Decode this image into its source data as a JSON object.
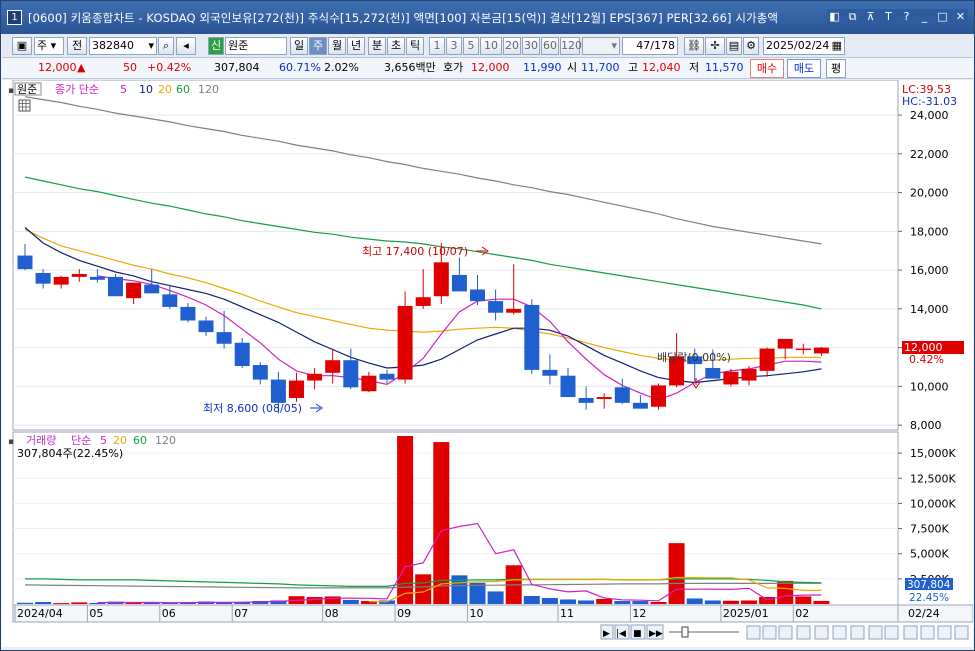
{
  "window": {
    "number": "1",
    "title": "[0600] 키움종합차트 - KOSDAQ 외국인보유[272(천)] 주식수[15,272(천)] 액면[100] 자본금[15(억)] 결산[12월] EPS[367] PER[32.66] 시가총액",
    "controls": [
      "◧",
      "⧉",
      "⊼",
      "T",
      "?",
      "_",
      "□",
      "✕"
    ]
  },
  "toolbar": {
    "period_type": "주",
    "prev_label": "전",
    "code": "382840",
    "name_badge": "신",
    "name": "원준",
    "periods": [
      "일",
      "주",
      "월",
      "년",
      "분",
      "초",
      "틱"
    ],
    "selected_period": "주",
    "numbers": [
      "1",
      "3",
      "5",
      "10",
      "20",
      "30",
      "60",
      "120"
    ],
    "count": "47/178",
    "date": "2025/02/24"
  },
  "quote": {
    "price": "12,000",
    "arrow": "▲",
    "change": "50",
    "change_pct": "+0.42%",
    "volume": "307,804",
    "ratio1": "60.71%",
    "ratio2": "2.02%",
    "amount": "3,656백만",
    "bid_label": "호가",
    "bid1": "12,000",
    "bid2": "11,990",
    "open_label": "시",
    "open": "11,700",
    "high_label": "고",
    "high": "12,040",
    "low_label": "저",
    "low": "11,570",
    "buy": "매수",
    "sell": "매도",
    "flat": "평"
  },
  "price_panel": {
    "legend_name": "원준",
    "legend_ma_label": "종가 단순",
    "ma_periods": [
      "5",
      "10",
      "20",
      "60",
      "120"
    ],
    "lc": "LC:39.53",
    "hc": "HC:-31.03",
    "last_price": "12,000",
    "last_pct": "0.42%",
    "high_note": "최고 17,400 (10/07)",
    "low_note": "최저 8,600 (08/05)",
    "dividend_note": "배당락(0.00%)",
    "y_ticks": [
      "24,000",
      "22,000",
      "20,000",
      "18,000",
      "16,000",
      "14,000",
      "12,000",
      "10,000",
      "8,000"
    ]
  },
  "volume_panel": {
    "legend_name": "거래량",
    "legend_ma_label": "단순",
    "ma_periods": [
      "5",
      "20",
      "60",
      "120"
    ],
    "info": "307,804주(22.45%)",
    "last_vol": "307,804",
    "last_pct": "22.45%",
    "y_ticks": [
      "15,000K",
      "12,500K",
      "10,000K",
      "7,500K",
      "5,000K",
      "2,500K"
    ]
  },
  "xaxis": {
    "labels": [
      "2024/04",
      "05",
      "06",
      "07",
      "08",
      "09",
      "10",
      "11",
      "12",
      "2025/01",
      "02"
    ],
    "right_label": "02/24"
  },
  "colors": {
    "up": "#e00000",
    "down": "#1f5fd0",
    "ma5": "#d020c0",
    "ma10": "#10207a",
    "ma20": "#f0a800",
    "ma60": "#10a040",
    "ma120": "#808080"
  },
  "chart_data": {
    "type": "candlestick",
    "ylim": [
      7800,
      25500
    ],
    "candles": [
      [
        16750,
        17350,
        16000,
        16050
      ],
      [
        15850,
        16050,
        15050,
        15300
      ],
      [
        15250,
        15700,
        15050,
        15650
      ],
      [
        15650,
        16050,
        15400,
        15800
      ],
      [
        15650,
        16050,
        15350,
        15500
      ],
      [
        15650,
        15800,
        14750,
        14650
      ],
      [
        14550,
        15350,
        14250,
        15350
      ],
      [
        15250,
        16050,
        14800,
        14800
      ],
      [
        14750,
        15250,
        14000,
        14100
      ],
      [
        14100,
        14300,
        13300,
        13400
      ],
      [
        13400,
        13600,
        12600,
        12800
      ],
      [
        12800,
        13900,
        11950,
        12200
      ],
      [
        12250,
        12500,
        10950,
        11050
      ],
      [
        11100,
        11250,
        10100,
        10350
      ],
      [
        10350,
        10750,
        8600,
        9150
      ],
      [
        9400,
        10700,
        9200,
        10300
      ],
      [
        10300,
        10950,
        9850,
        10650
      ],
      [
        10700,
        11950,
        10150,
        11350
      ],
      [
        11350,
        11950,
        9850,
        9950
      ],
      [
        9750,
        10750,
        9700,
        10550
      ],
      [
        10650,
        10850,
        10150,
        10350
      ],
      [
        10350,
        14900,
        10150,
        14150
      ],
      [
        14150,
        16050,
        14000,
        14600
      ],
      [
        14650,
        17400,
        14250,
        16400
      ],
      [
        15750,
        16650,
        14900,
        14900
      ],
      [
        15000,
        15750,
        14200,
        14400
      ],
      [
        14400,
        15000,
        13400,
        13800
      ],
      [
        13800,
        16300,
        13700,
        14000
      ],
      [
        14200,
        14500,
        10650,
        10850
      ],
      [
        10850,
        11650,
        10100,
        10550
      ],
      [
        10550,
        10950,
        9650,
        9450
      ],
      [
        9400,
        10000,
        8800,
        9150
      ],
      [
        9350,
        9650,
        8850,
        9450
      ],
      [
        9950,
        10400,
        9100,
        9150
      ],
      [
        9150,
        9550,
        8850,
        8850
      ],
      [
        8950,
        10150,
        8800,
        10050
      ],
      [
        10050,
        12750,
        9950,
        11550
      ],
      [
        11550,
        11950,
        10200,
        11150
      ],
      [
        10950,
        11900,
        10700,
        10400
      ],
      [
        10100,
        10900,
        10000,
        10750
      ],
      [
        10300,
        11050,
        10050,
        10900
      ],
      [
        10800,
        12000,
        10500,
        11950
      ],
      [
        11950,
        12400,
        11400,
        12450
      ],
      [
        11950,
        12200,
        11650,
        11950
      ],
      [
        11700,
        12040,
        11570,
        12000
      ]
    ],
    "ma5": [
      null,
      null,
      null,
      null,
      15700,
      15560,
      15450,
      15260,
      14950,
      14600,
      14200,
      13650,
      12950,
      12250,
      11400,
      10800,
      10550,
      10550,
      10450,
      10300,
      10100,
      10700,
      11450,
      12700,
      13850,
      14400,
      14500,
      14500,
      14100,
      13350,
      12300,
      11400,
      10600,
      10050,
      9650,
      9300,
      9650,
      10200,
      10650,
      10800,
      10900,
      11100,
      11300,
      11300,
      11250
    ],
    "ma10": [
      18200,
      17400,
      16900,
      16500,
      16200,
      15900,
      15700,
      15400,
      15200,
      15000,
      14800,
      14500,
      14100,
      13700,
      13300,
      12800,
      12300,
      11900,
      11500,
      11200,
      10950,
      11000,
      11100,
      11400,
      11900,
      12400,
      12700,
      13000,
      13000,
      12900,
      12600,
      12100,
      11600,
      11200,
      10800,
      10450,
      10300,
      10200,
      10300,
      10400,
      10500,
      10550,
      10650,
      10750,
      10900
    ],
    "ma20": [
      18100,
      17650,
      17250,
      17000,
      16750,
      16500,
      16250,
      16050,
      15800,
      15600,
      15350,
      15050,
      14750,
      14400,
      14100,
      13800,
      13600,
      13400,
      13200,
      13000,
      12900,
      12850,
      12800,
      12850,
      12950,
      13000,
      13050,
      13000,
      12850,
      12700,
      12500,
      12250,
      12000,
      11800,
      11600,
      11450,
      11350,
      11300,
      11350,
      11400,
      11450,
      11450,
      11500,
      11500,
      11500
    ],
    "ma60": [
      20800,
      20600,
      20400,
      20200,
      20050,
      19850,
      19650,
      19450,
      19300,
      19100,
      18900,
      18750,
      18550,
      18400,
      18250,
      18100,
      17950,
      17850,
      17700,
      17600,
      17500,
      17450,
      17350,
      17200,
      17100,
      16950,
      16800,
      16650,
      16500,
      16300,
      16150,
      16000,
      15850,
      15700,
      15550,
      15400,
      15250,
      15100,
      14950,
      14800,
      14650,
      14500,
      14350,
      14200,
      14000
    ],
    "ma120": [
      24950,
      24800,
      24650,
      24450,
      24300,
      24100,
      23950,
      23800,
      23650,
      23450,
      23300,
      23150,
      22950,
      22800,
      22650,
      22450,
      22300,
      22150,
      21950,
      21800,
      21600,
      21450,
      21250,
      21100,
      20950,
      20750,
      20600,
      20400,
      20250,
      20050,
      19900,
      19700,
      19500,
      19300,
      19100,
      18900,
      18650,
      18450,
      18250,
      18100,
      17950,
      17800,
      17650,
      17500,
      17350
    ],
    "vol_ylim": [
      0,
      17000
    ],
    "volume": [
      120,
      200,
      90,
      160,
      100,
      230,
      150,
      130,
      120,
      150,
      250,
      200,
      190,
      300,
      350,
      780,
      690,
      750,
      400,
      300,
      350,
      16700,
      2950,
      16100,
      2850,
      2100,
      1250,
      3850,
      800,
      600,
      450,
      350,
      500,
      300,
      290,
      200,
      6050,
      550,
      350,
      320,
      350,
      700,
      2300,
      750,
      310
    ],
    "vol_ma5": [
      null,
      null,
      null,
      null,
      140,
      160,
      150,
      160,
      130,
      140,
      160,
      170,
      180,
      210,
      260,
      360,
      460,
      570,
      590,
      570,
      510,
      3700,
      4100,
      7300,
      7700,
      8000,
      5000,
      5400,
      1950,
      1500,
      1200,
      1300,
      600,
      420,
      380,
      320,
      1470,
      1470,
      1480,
      1450,
      1560,
      410,
      800,
      880,
      890
    ],
    "vol_ma20": [
      null,
      null,
      null,
      null,
      null,
      null,
      null,
      null,
      null,
      null,
      null,
      null,
      null,
      null,
      null,
      null,
      null,
      null,
      null,
      220,
      230,
      1050,
      1190,
      2000,
      2110,
      2200,
      2240,
      2400,
      2420,
      2430,
      2430,
      2430,
      2440,
      2420,
      2420,
      2410,
      2630,
      2620,
      2600,
      2600,
      2400,
      1600,
      1550,
      1350,
      1350
    ],
    "vol_ma60": [
      2500,
      2500,
      2450,
      2400,
      2400,
      2400,
      2400,
      2350,
      2300,
      2250,
      2200,
      2150,
      2100,
      2050,
      2000,
      1900,
      1850,
      1800,
      1750,
      1750,
      1750,
      2050,
      2100,
      2350,
      2350,
      2400,
      2400,
      2450,
      2450,
      2450,
      2450,
      2450,
      2450,
      2400,
      2400,
      2400,
      2500,
      2500,
      2500,
      2500,
      2450,
      2350,
      2200,
      2150,
      2100
    ],
    "vol_ma120": [
      1900,
      1880,
      1850,
      1840,
      1820,
      1800,
      1780,
      1760,
      1740,
      1720,
      1700,
      1680,
      1660,
      1640,
      1620,
      1600,
      1600,
      1600,
      1600,
      1600,
      1600,
      1680,
      1700,
      1800,
      1820,
      1850,
      1870,
      1900,
      1900,
      1920,
      1940,
      1960,
      1980,
      2000,
      2000,
      2000,
      2050,
      2050,
      2050,
      2050,
      2050,
      2050,
      2060,
      2060,
      2060
    ]
  }
}
